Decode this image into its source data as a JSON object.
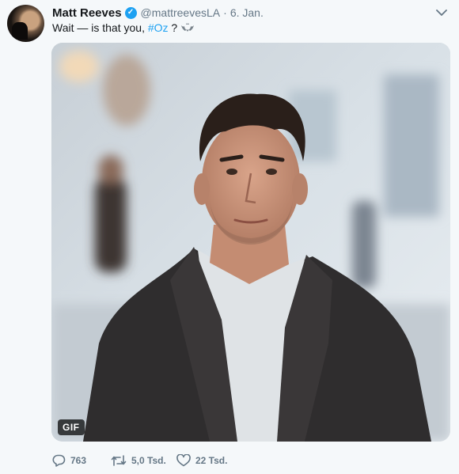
{
  "tweet": {
    "author_name": "Matt Reeves",
    "handle": "@mattreevesLA",
    "separator": "·",
    "date": "6. Jan.",
    "text_before": "Wait — is that you, ",
    "hashtag": "#Oz",
    "text_after": " ?",
    "media_badge": "GIF",
    "replies": "763",
    "retweets": "5,0 Tsd.",
    "likes": "22 Tsd."
  },
  "icons": {
    "verified": "verified-badge-icon",
    "menu": "chevron-down-icon",
    "bat": "bat-emoji-icon",
    "reply": "reply-icon",
    "retweet": "retweet-icon",
    "like": "heart-icon"
  },
  "colors": {
    "accent": "#1da1f2",
    "muted": "#657786",
    "text": "#14171a",
    "background": "#f5f8fa"
  }
}
